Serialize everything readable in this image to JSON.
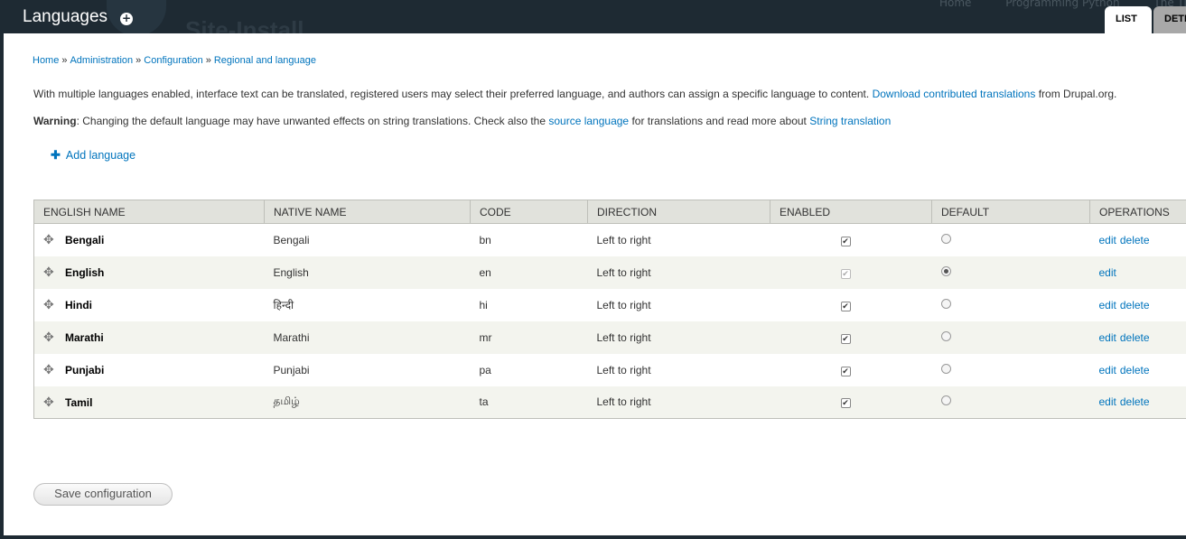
{
  "overlay": {
    "title": "Languages",
    "background_site_name": "Site-Install",
    "background_links": [
      "Home",
      "Programming Python",
      "The Tim"
    ],
    "tabs": [
      {
        "label": "LIST",
        "active": true
      },
      {
        "label": "DETE",
        "active": false
      }
    ]
  },
  "breadcrumb": [
    {
      "label": "Home"
    },
    {
      "label": "Administration"
    },
    {
      "label": "Configuration"
    },
    {
      "label": "Regional and language"
    }
  ],
  "breadcrumb_separator": "»",
  "intro": {
    "text": "With multiple languages enabled, interface text can be translated, registered users may select their preferred language, and authors can assign a specific language to content.",
    "link": "Download contributed translations",
    "suffix": "from Drupal.org."
  },
  "warning": {
    "label": "Warning",
    "text": ": Changing the default language may have unwanted effects on string translations. Check also the",
    "link1": "source language",
    "middle": "for translations and read more about",
    "link2": "String translation"
  },
  "add_language": {
    "label": "Add language",
    "icon": "plus-icon"
  },
  "table": {
    "headers": [
      "ENGLISH NAME",
      "NATIVE NAME",
      "CODE",
      "DIRECTION",
      "ENABLED",
      "DEFAULT",
      "OPERATIONS"
    ],
    "rows": [
      {
        "english": "Bengali",
        "native": "Bengali",
        "code": "bn",
        "direction": "Left to right",
        "enabled": true,
        "enabled_disabled": false,
        "default": false,
        "ops": [
          "edit",
          "delete"
        ]
      },
      {
        "english": "English",
        "native": "English",
        "code": "en",
        "direction": "Left to right",
        "enabled": true,
        "enabled_disabled": true,
        "default": true,
        "ops": [
          "edit"
        ]
      },
      {
        "english": "Hindi",
        "native": "हिन्दी",
        "code": "hi",
        "direction": "Left to right",
        "enabled": true,
        "enabled_disabled": false,
        "default": false,
        "ops": [
          "edit",
          "delete"
        ]
      },
      {
        "english": "Marathi",
        "native": "Marathi",
        "code": "mr",
        "direction": "Left to right",
        "enabled": true,
        "enabled_disabled": false,
        "default": false,
        "ops": [
          "edit",
          "delete"
        ]
      },
      {
        "english": "Punjabi",
        "native": "Punjabi",
        "code": "pa",
        "direction": "Left to right",
        "enabled": true,
        "enabled_disabled": false,
        "default": false,
        "ops": [
          "edit",
          "delete"
        ]
      },
      {
        "english": "Tamil",
        "native": "தமிழ்",
        "code": "ta",
        "direction": "Left to right",
        "enabled": true,
        "enabled_disabled": false,
        "default": false,
        "ops": [
          "edit",
          "delete"
        ]
      }
    ]
  },
  "save_button": {
    "label": "Save configuration"
  },
  "colors": {
    "link": "#0074bd",
    "header_bg": "#e1e2dc",
    "even_row": "#f3f4ee",
    "overlay_bg": "#1e2a33"
  }
}
